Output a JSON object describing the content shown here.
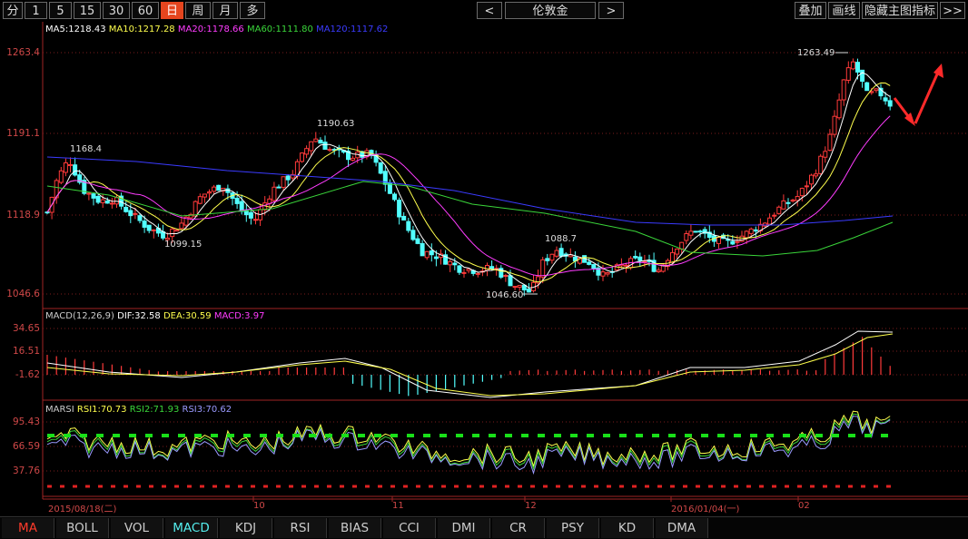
{
  "toolbar": {
    "periods": [
      "分",
      "1",
      "5",
      "15",
      "30",
      "60",
      "日",
      "周",
      "月",
      "多"
    ],
    "active_period": "日",
    "prev_label": "<",
    "symbol": "伦敦金",
    "next_label": ">",
    "overlay_label": "叠加",
    "draw_label": "画线",
    "hide_main_label": "隐藏主图指标",
    "more_label": ">>"
  },
  "main_legend": {
    "ma5": "MA5:1218.43",
    "ma10": "MA10:1217.28",
    "ma20": "MA20:1178.66",
    "ma60": "MA60:1111.80",
    "ma120": "MA120:1117.62"
  },
  "macd_legend": {
    "name": "MACD(12,26,9)",
    "dif": "DIF:32.58",
    "dea": "DEA:30.59",
    "macd": "MACD:3.97"
  },
  "rsi_legend": {
    "name": "MARSI",
    "rsi1": "RSI1:70.73",
    "rsi2": "RSI2:71.93",
    "rsi3": "RSI3:70.62"
  },
  "axis": {
    "price_ticks": [
      "1263.4",
      "1191.1",
      "1118.9",
      "1046.6"
    ],
    "macd_ticks": [
      "34.65",
      "16.51",
      "-1.62"
    ],
    "rsi_ticks": [
      "95.43",
      "66.59",
      "37.76"
    ],
    "dates": [
      "2015/08/18(二)",
      "10",
      "11",
      "12",
      "2016/01/04(一)",
      "02"
    ]
  },
  "annotations": {
    "high1": "1168.4",
    "low1": "1099.15",
    "high2": "1190.63",
    "low2": "1046.60",
    "high3": "1088.7",
    "high4": "1263.49"
  },
  "bottom_tabs": [
    "MA",
    "BOLL",
    "VOL",
    "MACD",
    "KDJ",
    "RSI",
    "BIAS",
    "CCI",
    "DMI",
    "CR",
    "PSY",
    "KD",
    "DMA"
  ],
  "colors": {
    "up": "#ff3a3a",
    "down": "#52ffff",
    "ma5": "#ffffff",
    "ma10": "#ffff4d",
    "ma20": "#ff3cff",
    "ma60": "#3ad53a",
    "ma120": "#3b3bff",
    "active_tab": "#e5451e"
  },
  "chart_data": {
    "type": "candlestick",
    "symbol": "伦敦金",
    "period": "日",
    "price_range": [
      1046.6,
      1263.4
    ],
    "key_points": [
      {
        "date": "2015/08/24",
        "label": "1168.4",
        "price": 1168.4
      },
      {
        "date": "2015/09/17",
        "label": "1099.15",
        "price": 1099.15
      },
      {
        "date": "2015/10/15",
        "label": "1190.63",
        "price": 1190.63
      },
      {
        "date": "2015/12/03",
        "label": "1046.60",
        "price": 1046.6
      },
      {
        "date": "2015/12/10",
        "label": "1088.7",
        "price": 1088.7
      },
      {
        "date": "2016/02/11",
        "label": "1263.49",
        "price": 1263.49
      }
    ],
    "moving_averages": {
      "MA5": 1218.43,
      "MA10": 1217.28,
      "MA20": 1178.66,
      "MA60": 1111.8,
      "MA120": 1117.62
    },
    "macd": {
      "params": "12,26,9",
      "DIF": 32.58,
      "DEA": 30.59,
      "MACD": 3.97,
      "ylim": [
        -1.62,
        34.65
      ]
    },
    "rsi": {
      "RSI1": 70.73,
      "RSI2": 71.93,
      "RSI3": 70.62,
      "ylim": [
        37.76,
        95.43
      ]
    },
    "x_labels": [
      "2015/08/18(二)",
      "10",
      "11",
      "12",
      "2016/01/04(一)",
      "02"
    ]
  }
}
